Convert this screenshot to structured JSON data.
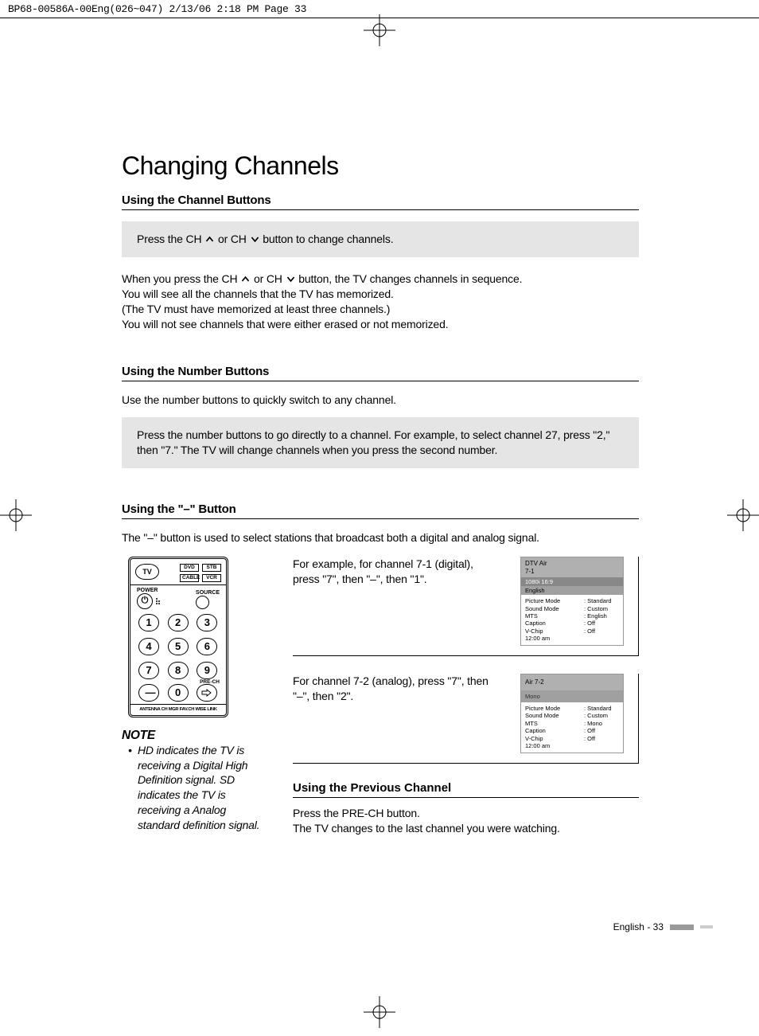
{
  "header_line": "BP68-00586A-00Eng(026~047)  2/13/06  2:18 PM  Page 33",
  "title": "Changing Channels",
  "s1": {
    "heading": "Using the Channel Buttons",
    "gray_a": "Press the CH ",
    "gray_b": " or CH ",
    "gray_c": " button to change channels.",
    "p1_a": "When you press the CH ",
    "p1_b": " or CH ",
    "p1_c": " button, the TV changes channels in sequence.",
    "p2": "You will see all the channels that the TV has memorized.",
    "p3": "(The TV must have memorized at least three channels.)",
    "p4": "You will not see channels that were either erased or not memorized."
  },
  "s2": {
    "heading": "Using the Number Buttons",
    "intro": "Use the number buttons to quickly switch to any channel.",
    "gray": "Press the number buttons to go directly to a channel. For example, to select channel 27, press \"2,\" then \"7.\" The TV will change channels when you press the second number."
  },
  "s3": {
    "heading": "Using the \"–\" Button",
    "intro": "The \"–\" button is used to select stations that broadcast both a digital and analog signal.",
    "ex1": "For example, for channel 7-1 (digital), press \"7\", then \"–\", then \"1\".",
    "ex2": "For channel 7-2 (analog), press \"7\", then \"–\", then \"2\"."
  },
  "remote": {
    "tv": "TV",
    "dvd": "DVD",
    "stb": "STB",
    "cable": "CABLE",
    "vcr": "VCR",
    "power": "POWER",
    "source": "SOURCE",
    "nums": [
      "1",
      "2",
      "3",
      "4",
      "5",
      "6",
      "7",
      "8",
      "9",
      "—",
      "0"
    ],
    "prech": "PRE-CH",
    "footer": "ANTENNA  CH MGR   FAV.CH  WISE LINK"
  },
  "note": {
    "heading": "NOTE",
    "text": "HD indicates the TV is receiving a Digital High Definition signal. SD indicates the TV is receiving a Analog standard definition signal."
  },
  "osd1": {
    "h1": "DTV Air",
    "h2": "7-1",
    "sub": "1080i 16:9",
    "sub2": "English",
    "rows_l": "Picture Mode\nSound Mode\nMTS\nCaption\nV-Chip\n12:00 am",
    "rows_r": ": Standard\n: Custom\n: English\n: Off\n: Off"
  },
  "osd2": {
    "h1": "Air 7-2",
    "sub": "Mono",
    "rows_l": "Picture Mode\nSound Mode\nMTS\nCaption\nV-Chip\n12:00 am",
    "rows_r": ": Standard\n: Custom\n: Mono\n: Off\n: Off"
  },
  "s4": {
    "heading": "Using the Previous Channel",
    "p1": "Press the PRE-CH button.",
    "p2": "The TV changes to the last channel you were watching."
  },
  "footer_text": "English - 33"
}
